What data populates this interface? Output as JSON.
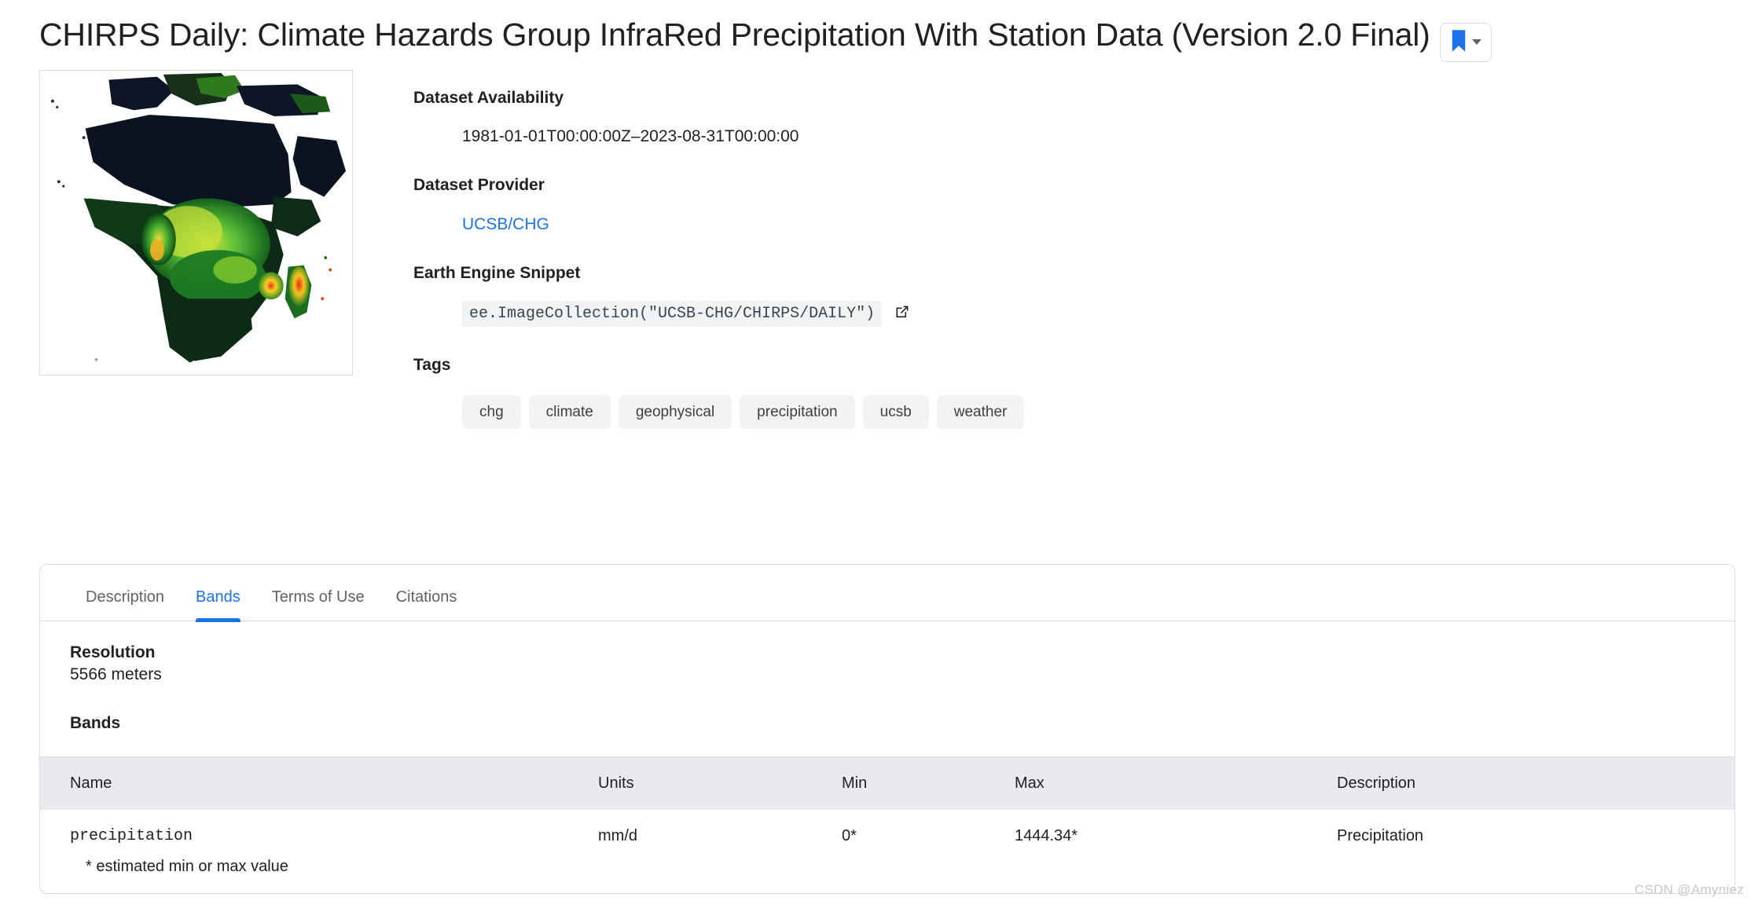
{
  "header": {
    "title": "CHIRPS Daily: Climate Hazards Group InfraRed Precipitation With Station Data (Version 2.0 Final)",
    "bookmark_button": {
      "icon": "bookmark-icon",
      "dropdown_icon": "chevron-down-icon"
    }
  },
  "thumbnail": {
    "alt": "CHIRPS precipitation map of Africa"
  },
  "metadata": {
    "availability_label": "Dataset Availability",
    "availability_value": "1981-01-01T00:00:00Z–2023-08-31T00:00:00",
    "provider_label": "Dataset Provider",
    "provider_value": "UCSB/CHG",
    "snippet_label": "Earth Engine Snippet",
    "snippet_code": "ee.ImageCollection(\"UCSB-CHG/CHIRPS/DAILY\")",
    "snippet_external_icon": "external-link-icon",
    "tags_label": "Tags",
    "tags": [
      "chg",
      "climate",
      "geophysical",
      "precipitation",
      "ucsb",
      "weather"
    ]
  },
  "tabs": [
    {
      "label": "Description",
      "active": false
    },
    {
      "label": "Bands",
      "active": true
    },
    {
      "label": "Terms of Use",
      "active": false
    },
    {
      "label": "Citations",
      "active": false
    }
  ],
  "bands_panel": {
    "resolution_label": "Resolution",
    "resolution_value": "5566 meters",
    "bands_label": "Bands",
    "columns": [
      "Name",
      "Units",
      "Min",
      "Max",
      "Description"
    ],
    "rows": [
      {
        "name": "precipitation",
        "units": "mm/d",
        "min": "0*",
        "max": "1444.34*",
        "description": "Precipitation"
      }
    ],
    "footnote": "* estimated min or max value"
  },
  "watermark": "CSDN @Amyniez",
  "colors": {
    "accent": "#1a73e8",
    "link": "#1a73e8",
    "text": "#202124",
    "muted_text": "#5f6368",
    "table_header_bg": "#e8eaed",
    "chip_bg": "#f1f3f4",
    "border": "#dadce0"
  }
}
